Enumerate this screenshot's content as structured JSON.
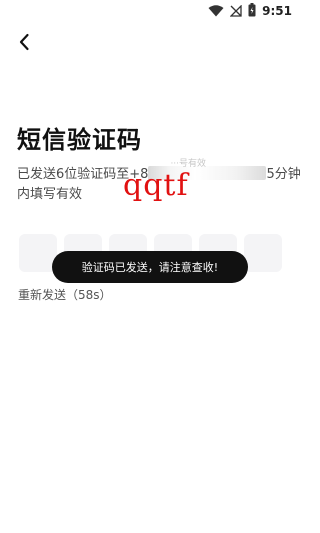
{
  "status_bar": {
    "time": "9:51",
    "icons": [
      "wifi-icon",
      "signal-icon",
      "battery-icon"
    ]
  },
  "header": {
    "back_icon": "chevron-left-icon"
  },
  "page": {
    "title": "短信验证码",
    "info_prefix": "已发送6位验证码至+8",
    "info_masked_ghost": "···号有效",
    "info_suffix": "5分钟",
    "info_line2": "内填写有效"
  },
  "watermark": {
    "text": "qqtf",
    "color": "#e11111"
  },
  "code_input": {
    "length": 6,
    "values": [
      "",
      "",
      "",
      "",
      "",
      ""
    ]
  },
  "toast": {
    "message": "验证码已发送，请注意查收!"
  },
  "resend": {
    "label": "重新发送（58s）"
  }
}
